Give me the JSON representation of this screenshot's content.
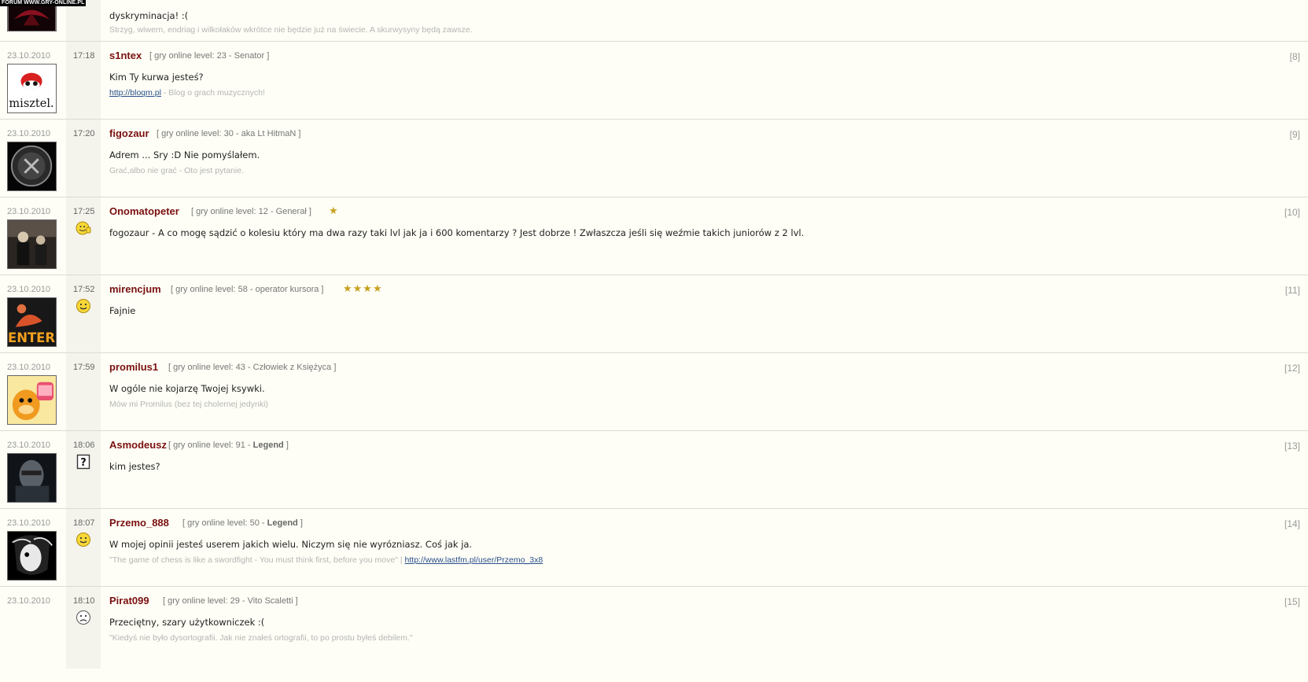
{
  "watermark": "FORUM WWW.GRY-ONLINE.PL",
  "level_prefix": "[ gry online level: ",
  "level_suffix": " ]",
  "top_post": {
    "text": "dyskryminacja! :(",
    "signature": "Strzyg, wiwern, endriag i wilkołaków wkrótce nie będzie już na świecie. A skurwysyny będą zawsze."
  },
  "posts": [
    {
      "date": "23.10.2010",
      "time": "17:18",
      "user": "s1ntex",
      "level": "23",
      "rank": "Senator",
      "rank_bold": false,
      "stars": "",
      "emoticon": "",
      "number": "[8]",
      "text": "Kim Ty kurwa jesteś?",
      "sig_link": "http://bloqm.pl",
      "sig_text": " - Blog o grach muzycznych!",
      "avatar_text": "misztel."
    },
    {
      "date": "23.10.2010",
      "time": "17:20",
      "user": "figozaur",
      "level": "30",
      "rank": "aka Lt HitmaN",
      "rank_bold": false,
      "stars": "",
      "emoticon": "",
      "number": "[9]",
      "text": "Adrem ... Sry :D Nie pomyślałem.",
      "sig_link": "",
      "sig_text": "Grać,albo nie grać - Oto jest pytanie.",
      "avatar_text": ""
    },
    {
      "date": "23.10.2010",
      "time": "17:25",
      "user": "Onomatopeter",
      "level": "12",
      "rank": "Generał",
      "rank_bold": false,
      "stars": "★",
      "emoticon": "thumbs-up",
      "number": "[10]",
      "text": "fogozaur - A co mogę sądzić o kolesiu który ma dwa razy taki lvl jak ja i 600 komentarzy ? Jest dobrze ! Zwłaszcza jeśli się weźmie takich juniorów z 2 lvl.",
      "sig_link": "",
      "sig_text": "",
      "avatar_text": ""
    },
    {
      "date": "23.10.2010",
      "time": "17:52",
      "user": "mirencjum",
      "level": "58",
      "rank": "operator kursora",
      "rank_bold": false,
      "stars": "★★★★",
      "emoticon": "smile",
      "number": "[11]",
      "text": "Fajnie",
      "sig_link": "",
      "sig_text": "",
      "avatar_text": "ENTER"
    },
    {
      "date": "23.10.2010",
      "time": "17:59",
      "user": "promilus1",
      "level": "43",
      "rank": "Człowiek z Księżyca",
      "rank_bold": false,
      "stars": "",
      "emoticon": "",
      "number": "[12]",
      "text": "W ogóle nie kojarzę Twojej ksywki.",
      "sig_link": "",
      "sig_text": "Mów mi Promilus (bez tej cholernej jedynki)",
      "avatar_text": ""
    },
    {
      "date": "23.10.2010",
      "time": "18:06",
      "user": "Asmodeusz",
      "level": "91",
      "rank": "Legend",
      "rank_bold": true,
      "stars": "",
      "emoticon": "question",
      "number": "[13]",
      "text": "kim jestes?",
      "sig_link": "",
      "sig_text": "",
      "avatar_text": ""
    },
    {
      "date": "23.10.2010",
      "time": "18:07",
      "user": "Przemo_888",
      "level": "50",
      "rank": "Legend",
      "rank_bold": true,
      "stars": "",
      "emoticon": "smile",
      "number": "[14]",
      "text": "W mojej opinii jesteś userem jakich wielu. Niczym się nie wyrózniasz. Coś jak ja.",
      "sig_text_before": "\"The game of chess is like a swordfight - You must think first, before you move\" | ",
      "sig_link": "http://www.lastfm.pl/user/Przemo_3x8",
      "sig_text": "",
      "avatar_text": ""
    },
    {
      "date": "23.10.2010",
      "time": "18:10",
      "user": "Pirat099",
      "level": "29",
      "rank": "Vito Scaletti",
      "rank_bold": false,
      "stars": "",
      "emoticon": "sad",
      "number": "[15]",
      "text": "Przeciętny, szary użytkowniczek :(",
      "sig_link": "",
      "sig_text": "\"Kiedyś nie było dysortografii. Jak nie znałeś ortografii, to po prostu byłeś debilem.\"",
      "avatar_text": ""
    }
  ]
}
